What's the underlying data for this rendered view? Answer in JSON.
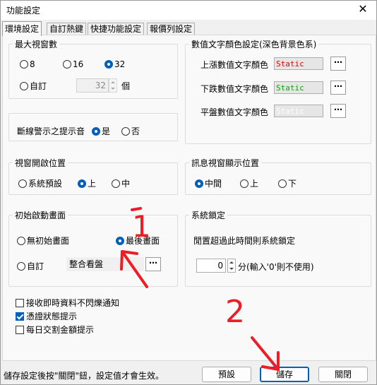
{
  "window": {
    "title": "功能設定",
    "close_glyph": "✕"
  },
  "tabs": [
    "環境設定",
    "自訂熱鍵",
    "快捷功能設定",
    "報價列設定"
  ],
  "max_windows": {
    "legend": "最大視窗數",
    "options": [
      "8",
      "16",
      "32"
    ],
    "selected": "32",
    "custom_label": "自訂",
    "custom_value": "32",
    "unit": "個"
  },
  "disconnect": {
    "label": "斷線警示之提示音",
    "options": [
      "是",
      "否"
    ],
    "selected": "是"
  },
  "window_open_position": {
    "legend": "視窗開啟位置",
    "options": [
      "系統預設",
      "上",
      "中"
    ],
    "selected": "上"
  },
  "startup_screen": {
    "legend": "初始啟動畫面",
    "options": [
      "無初始畫面",
      "最後畫面",
      "自訂"
    ],
    "selected": "最後畫面",
    "custom_value": "整合看盤",
    "browse_glyph": "⋯"
  },
  "checkboxes": [
    {
      "label": "接收即時資料不閃爍通知",
      "checked": false
    },
    {
      "label": "憑證狀態提示",
      "checked": true
    },
    {
      "label": "每日交割金額提示",
      "checked": false
    }
  ],
  "text_colors": {
    "legend": "數值文字顏色設定(深色背景色系)",
    "rows": [
      {
        "label": "上漲數值文字顏色",
        "sample": "Static",
        "color": "#e00000"
      },
      {
        "label": "下跌數值文字顏色",
        "sample": "Static",
        "color": "#00aa00"
      },
      {
        "label": "平盤數值文字顏色",
        "sample": "Static",
        "color": "#ffffff"
      }
    ],
    "browse_glyph": "⋯"
  },
  "message_position": {
    "legend": "訊息視窗顯示位置",
    "options": [
      "中間",
      "上",
      "下"
    ],
    "selected": "中間"
  },
  "system_lock": {
    "legend": "系統鎖定",
    "description": "閒置超過此時間則系統鎖定",
    "value": "0",
    "hint": "分(輸入'0'則不使用)"
  },
  "status_text": "儲存設定後按\"關閉\"鈕，設定值才會生效。",
  "buttons": {
    "default": "預設",
    "save": "儲存",
    "close": "關閉"
  },
  "annotations": {
    "mark_1": "1",
    "mark_2": "2",
    "color": "#ee1c24"
  }
}
